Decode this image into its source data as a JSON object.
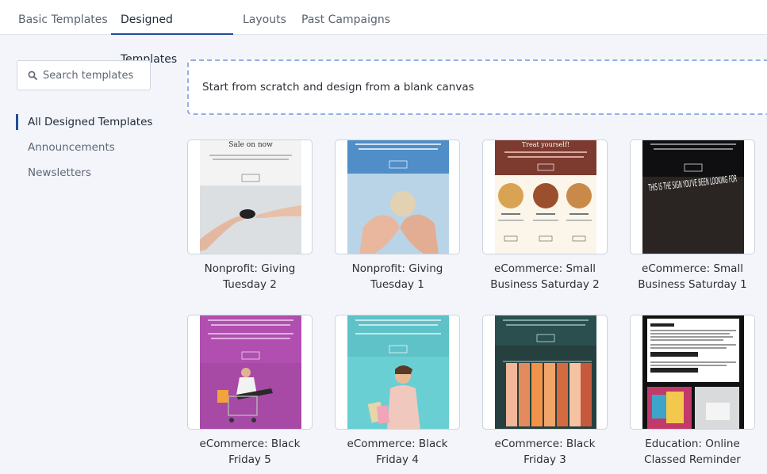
{
  "tabs": [
    {
      "label": "Basic Templates"
    },
    {
      "label": "Designed Templates"
    },
    {
      "label": "Layouts"
    },
    {
      "label": "Past Campaigns"
    }
  ],
  "search": {
    "placeholder": "Search templates"
  },
  "sidebar": {
    "items": [
      {
        "label": "All Designed Templates"
      },
      {
        "label": "Announcements"
      },
      {
        "label": "Newsletters"
      }
    ]
  },
  "blank_canvas": {
    "label": "Start from scratch and design from a blank canvas"
  },
  "templates": [
    {
      "line1": "Nonprofit: Giving",
      "line2": "Tuesday 2",
      "thumb_text": "Sale on now"
    },
    {
      "line1": "Nonprofit: Giving",
      "line2": "Tuesday 1"
    },
    {
      "line1": "eCommerce: Small",
      "line2": "Business Saturday 2",
      "thumb_text": "Treat yourself!"
    },
    {
      "line1": "eCommerce: Small",
      "line2": "Business Saturday 1",
      "thumb_text": "THIS IS THE SIGN YOU'VE BEEN LOOKING FOR"
    },
    {
      "line1": "eCommerce: Black",
      "line2": "Friday 5"
    },
    {
      "line1": "eCommerce: Black",
      "line2": "Friday 4"
    },
    {
      "line1": "eCommerce: Black",
      "line2": "Friday 3"
    },
    {
      "line1": "Education: Online",
      "line2": "Classed Reminder"
    }
  ],
  "colors": {
    "accent": "#1f4f99",
    "dashed_border": "#8fb0e6"
  }
}
